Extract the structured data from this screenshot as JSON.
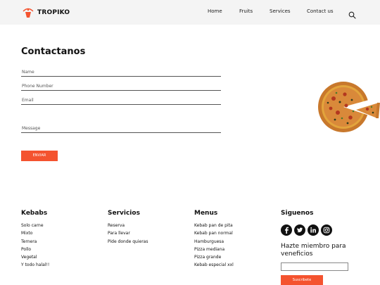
{
  "brand": {
    "name": "TROPIKO",
    "logo_text": "TROPIKO",
    "accent_color": "#f4532f"
  },
  "nav": {
    "items": [
      {
        "label": "Home"
      },
      {
        "label": "Fruits"
      },
      {
        "label": "Services"
      },
      {
        "label": "Contact us"
      }
    ],
    "search_icon": "search-icon"
  },
  "contact": {
    "title": "Contactanos",
    "fields": {
      "name": {
        "placeholder": "Name",
        "value": ""
      },
      "phone": {
        "placeholder": "Phone Number",
        "value": ""
      },
      "email": {
        "placeholder": "Email",
        "value": ""
      },
      "message": {
        "placeholder": "Message",
        "value": ""
      }
    },
    "send_label": "ENVIAR"
  },
  "footer": {
    "kebabs": {
      "title": "Kebabs",
      "items": [
        "Solo carne",
        "Mixto",
        "Ternera",
        "Pollo",
        "Vegetal",
        "Y todo halal!!"
      ]
    },
    "servicios": {
      "title": "Servicios",
      "items": [
        "Reserva",
        "Para llevar",
        "Pide donde quieras"
      ]
    },
    "menus": {
      "title": "Menus",
      "items": [
        "Kebab pan de pita",
        "Kebab pan normal",
        "Hamburguesa",
        "Pizza mediana",
        "Pizza grande",
        "Kebab especial xxl"
      ]
    },
    "siguenos": {
      "title": "Siguenos",
      "icons": [
        "facebook-icon",
        "twitter-icon",
        "linkedin-icon",
        "instagram-icon"
      ]
    },
    "newsletter": {
      "title": "Hazte miembro para veneficios",
      "value": "",
      "subscribe_label": "Suscribete"
    }
  }
}
